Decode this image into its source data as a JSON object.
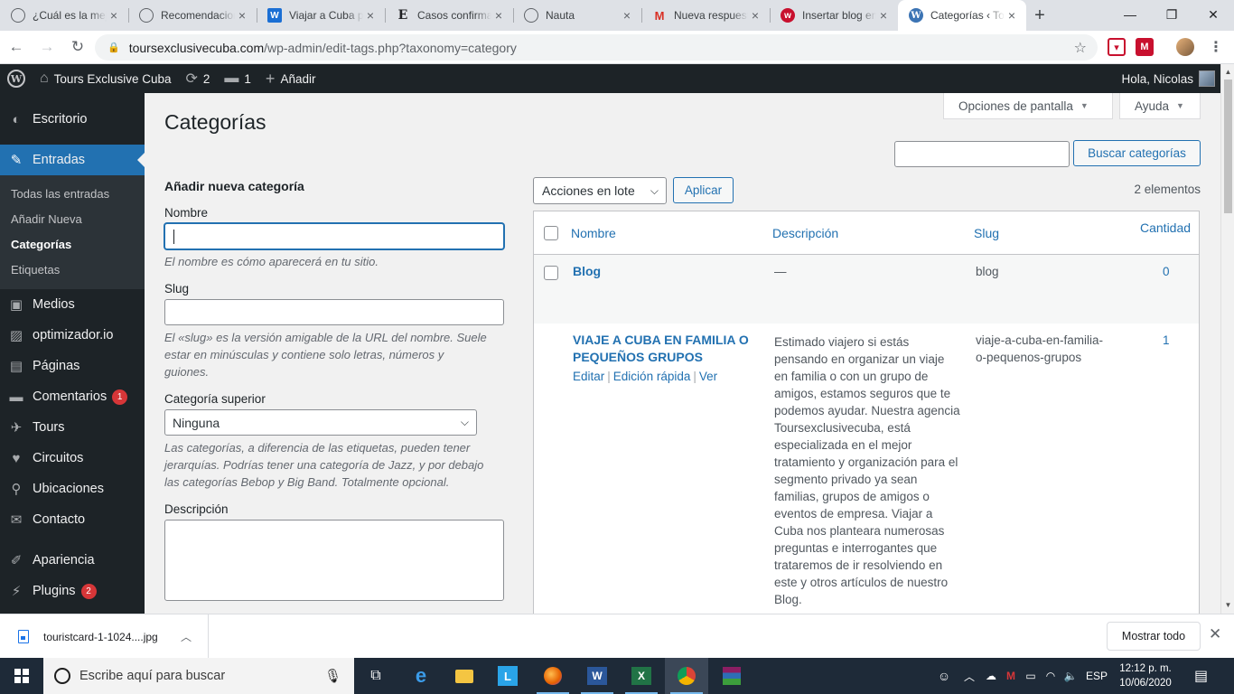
{
  "browser": {
    "tabs": [
      {
        "title": "¿Cuál es la mejor",
        "icon": "globe-icon",
        "active": false
      },
      {
        "title": "Recomendaciones",
        "icon": "globe-icon",
        "active": false
      },
      {
        "title": "Viajar a Cuba por",
        "icon": "wix-icon",
        "active": false
      },
      {
        "title": "Casos confirmados",
        "icon": "e-icon",
        "active": false
      },
      {
        "title": "Nauta",
        "icon": "globe-icon",
        "active": false
      },
      {
        "title": "Nueva respuesta",
        "icon": "gmail-icon",
        "active": false
      },
      {
        "title": "Insertar blog en",
        "icon": "w-icon",
        "active": false
      },
      {
        "title": "Categorías ‹ Tours",
        "icon": "wordpress-icon",
        "active": true
      }
    ],
    "url_host": "toursexclusivecuba.com",
    "url_path": "/wp-admin/edit-tags.php?taxonomy=category"
  },
  "adminbar": {
    "site_name": "Tours Exclusive Cuba",
    "updates_count": "2",
    "comments_count": "1",
    "new_label": "Añadir",
    "greeting": "Hola, Nicolas"
  },
  "sidebar": {
    "items": [
      {
        "label": "Escritorio",
        "icon": "dashboard-icon"
      },
      {
        "label": "Entradas",
        "icon": "pin-icon",
        "current": true
      },
      {
        "label": "Medios",
        "icon": "media-icon"
      },
      {
        "label": "optimizador.io",
        "icon": "image-icon"
      },
      {
        "label": "Páginas",
        "icon": "pages-icon"
      },
      {
        "label": "Comentarios",
        "icon": "comment-icon",
        "badge": "1"
      },
      {
        "label": "Tours",
        "icon": "plane-icon"
      },
      {
        "label": "Circuitos",
        "icon": "heart-icon"
      },
      {
        "label": "Ubicaciones",
        "icon": "location-icon"
      },
      {
        "label": "Contacto",
        "icon": "mail-icon"
      },
      {
        "label": "Apariencia",
        "icon": "brush-icon"
      },
      {
        "label": "Plugins",
        "icon": "plugin-icon",
        "badge": "2"
      }
    ],
    "submenu": [
      {
        "label": "Todas las entradas"
      },
      {
        "label": "Añadir Nueva"
      },
      {
        "label": "Categorías",
        "current": true
      },
      {
        "label": "Etiquetas"
      }
    ]
  },
  "page": {
    "screen_options": "Opciones de pantalla",
    "help": "Ayuda",
    "title": "Categorías",
    "search_button": "Buscar categorías",
    "form": {
      "heading": "Añadir nueva categoría",
      "name_label": "Nombre",
      "name_help": "El nombre es cómo aparecerá en tu sitio.",
      "slug_label": "Slug",
      "slug_help": "El «slug» es la versión amigable de la URL del nombre. Suele estar en minúsculas y contiene solo letras, números y guiones.",
      "parent_label": "Categoría superior",
      "parent_value": "Ninguna",
      "parent_help": "Las categorías, a diferencia de las etiquetas, pueden tener jerarquías. Podrías tener una categoría de Jazz, y por debajo las categorías Bebop y Big Band. Totalmente opcional.",
      "description_label": "Descripción"
    },
    "bulk_actions": "Acciones en lote",
    "apply": "Aplicar",
    "item_count": "2 elementos",
    "table": {
      "headers": {
        "name": "Nombre",
        "description": "Descripción",
        "slug": "Slug",
        "count": "Cantidad"
      },
      "rows": [
        {
          "name": "Blog",
          "description": "—",
          "slug": "blog",
          "count": "0"
        },
        {
          "name": "VIAJE A CUBA EN FAMILIA O PEQUEÑOS GRUPOS",
          "description": "Estimado viajero si estás pensando en organizar un viaje en familia o con un grupo de amigos, estamos seguros que te podemos ayudar. Nuestra agencia Toursexclusivecuba, está especializada en el mejor tratamiento y organización para el segmento privado ya sean familias, grupos de amigos o eventos de empresa. Viajar a Cuba nos planteara numerosas preguntas e interrogantes que trataremos de ir resolviendo en este y otros artículos de nuestro Blog.",
          "slug": "viaje-a-cuba-en-familia-o-pequenos-grupos",
          "count": "1",
          "actions": {
            "edit": "Editar",
            "quick_edit": "Edición rápida",
            "view": "Ver"
          }
        }
      ]
    }
  },
  "downloads": {
    "file": "touristcard-1-1024....jpg",
    "show_all": "Mostrar todo"
  },
  "taskbar": {
    "search_placeholder": "Escribe aquí para buscar",
    "language": "ESP",
    "time": "12:12 p. m.",
    "date": "10/06/2020"
  }
}
